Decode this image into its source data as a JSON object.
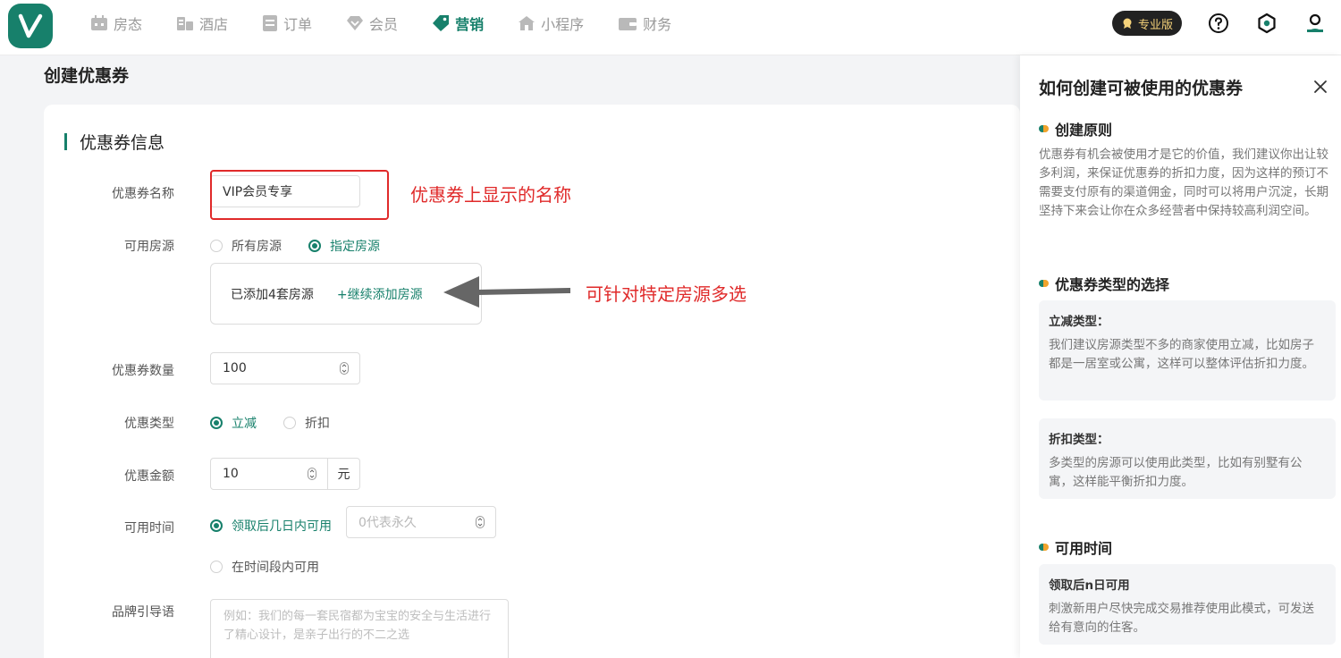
{
  "nav": {
    "items": [
      {
        "label": "房态",
        "icon": "calendar-icon"
      },
      {
        "label": "酒店",
        "icon": "hotel-icon"
      },
      {
        "label": "订单",
        "icon": "order-icon"
      },
      {
        "label": "会员",
        "icon": "diamond-icon"
      },
      {
        "label": "营销",
        "icon": "tag-icon",
        "active": true
      },
      {
        "label": "小程序",
        "icon": "house-icon"
      },
      {
        "label": "财务",
        "icon": "wallet-icon"
      }
    ],
    "pro_label": "专业版"
  },
  "colors": {
    "accent": "#17806b",
    "annotation": "#e02a2a"
  },
  "page": {
    "title": "创建优惠券"
  },
  "form": {
    "section_title": "优惠券信息",
    "name": {
      "label": "优惠券名称",
      "value": "VIP会员专享"
    },
    "rooms": {
      "label": "可用房源",
      "option_all": "所有房源",
      "option_specific": "指定房源",
      "added_text": "已添加4套房源",
      "add_more": "+继续添加房源"
    },
    "quantity": {
      "label": "优惠券数量",
      "value": "100"
    },
    "type": {
      "label": "优惠类型",
      "option_reduce": "立减",
      "option_discount": "折扣"
    },
    "amount": {
      "label": "优惠金额",
      "value": "10",
      "unit": "元"
    },
    "time": {
      "label": "可用时间",
      "option_days": "领取后几日内可用",
      "days_placeholder": "0代表永久",
      "option_period": "在时间段内可用"
    },
    "slogan": {
      "label": "品牌引导语",
      "placeholder": "例如：我们的每一套民宿都为宝宝的安全与生活进行了精心设计，是亲子出行的不二之选"
    }
  },
  "annotations": {
    "name_note": "优惠券上显示的名称",
    "rooms_note": "可针对特定房源多选"
  },
  "panel": {
    "title": "如何创建可被使用的优惠券",
    "s1": {
      "title": "创建原则",
      "text": "优惠券有机会被使用才是它的价值，我们建议你出让较多利润，来保证优惠券的折扣力度，因为这样的预订不需要支付原有的渠道佣金，同时可以将用户沉淀，长期坚持下来会让你在众多经营者中保持较高利润空间。"
    },
    "s2": {
      "title": "优惠券类型的选择",
      "tips": [
        {
          "title": "立减类型：",
          "text": "我们建议房源类型不多的商家使用立减，比如房子都是一居室或公寓，这样可以整体评估折扣力度。"
        },
        {
          "title": "折扣类型：",
          "text": "多类型的房源可以使用此类型，比如有别墅有公寓，这样能平衡折扣力度。"
        }
      ]
    },
    "s3": {
      "title": "可用时间",
      "tips": [
        {
          "title": "领取后n日可用",
          "text": "刺激新用户尽快完成交易推荐使用此模式，可发送给有意向的住客。"
        }
      ]
    }
  }
}
